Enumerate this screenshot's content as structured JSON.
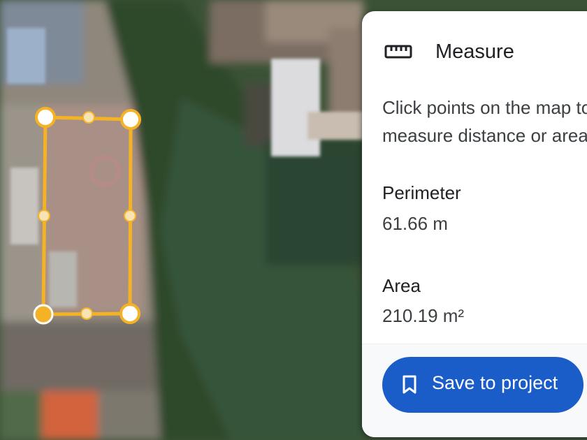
{
  "map": {
    "measurement_shape": "rectangle",
    "handle_icons": [
      "corner-handle",
      "midpoint-handle"
    ]
  },
  "panel": {
    "icon": "ruler-icon",
    "title": "Measure",
    "instructions": "Click points on the map to measure distance or area",
    "perimeter_label": "Perimeter",
    "perimeter_value": "61.66 m",
    "area_label": "Area",
    "area_value": "210.19 m²"
  },
  "save_button": {
    "icon": "bookmark-icon",
    "label": "Save to project",
    "color": "#1a5dc9"
  },
  "colors": {
    "measure_line": "#f5b225",
    "handle_fill": "#ffffff"
  }
}
